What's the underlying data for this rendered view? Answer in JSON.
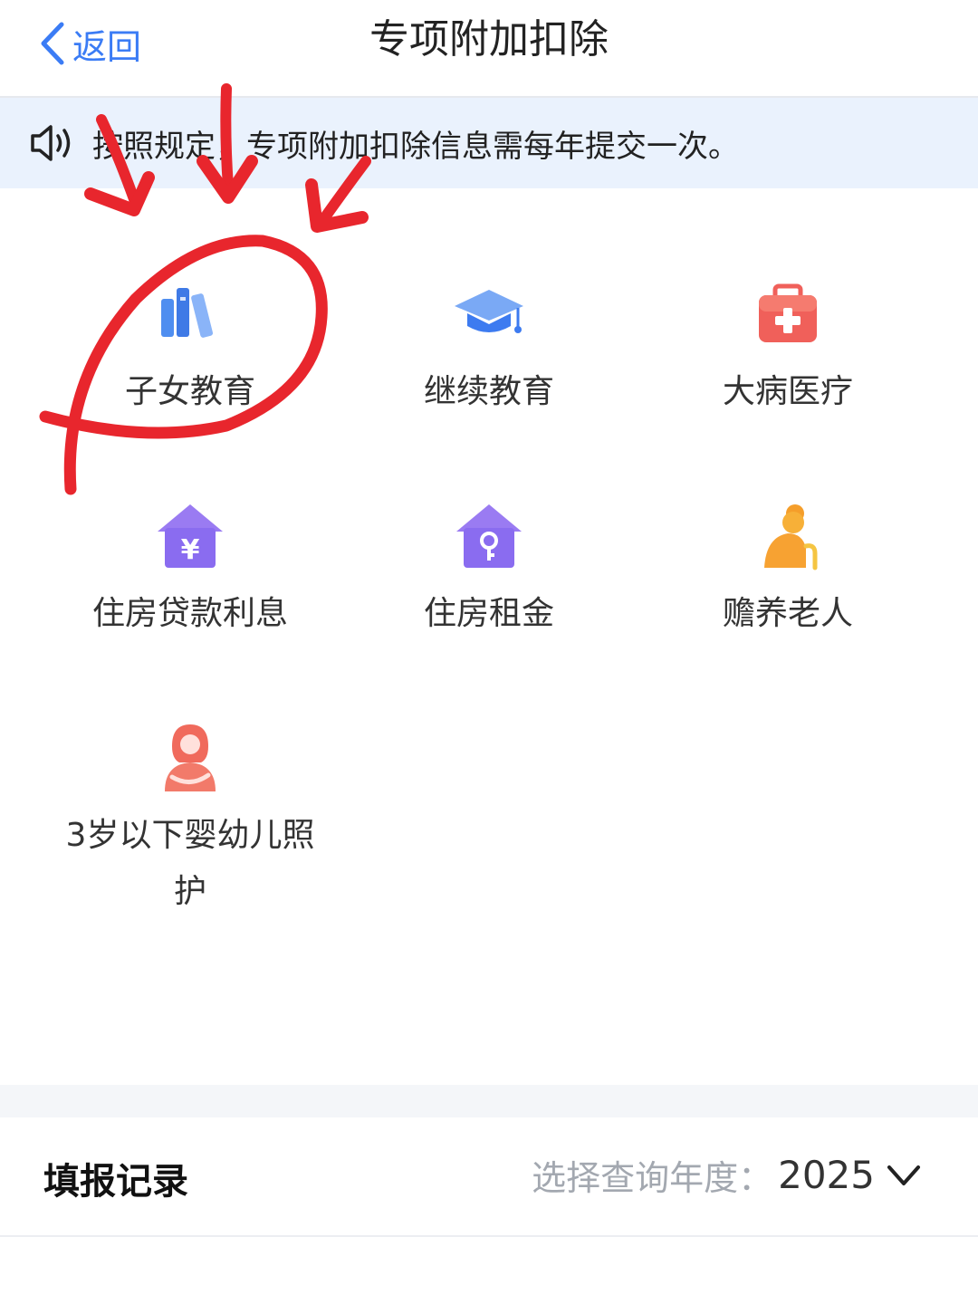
{
  "nav": {
    "back_label": "返回",
    "title": "专项附加扣除"
  },
  "notice": {
    "text": "按照规定，专项附加扣除信息需每年提交一次。",
    "icon": "speaker-icon"
  },
  "categories": [
    {
      "label": "子女教育",
      "icon": "books-icon"
    },
    {
      "label": "继续教育",
      "icon": "graduation-cap-icon"
    },
    {
      "label": "大病医疗",
      "icon": "first-aid-kit-icon"
    },
    {
      "label": "住房贷款利息",
      "icon": "house-yen-icon"
    },
    {
      "label": "住房租金",
      "icon": "house-key-icon"
    },
    {
      "label": "赡养老人",
      "icon": "elderly-person-icon"
    },
    {
      "label": "3岁以下婴幼儿照护",
      "icon": "mother-baby-icon"
    }
  ],
  "records": {
    "title": "填报记录",
    "year_prompt": "选择查询年度：",
    "year": "2025"
  },
  "colors": {
    "accent": "#3b7cf5",
    "notice_bg": "#eaf2fd",
    "annotation": "#e8262d"
  }
}
